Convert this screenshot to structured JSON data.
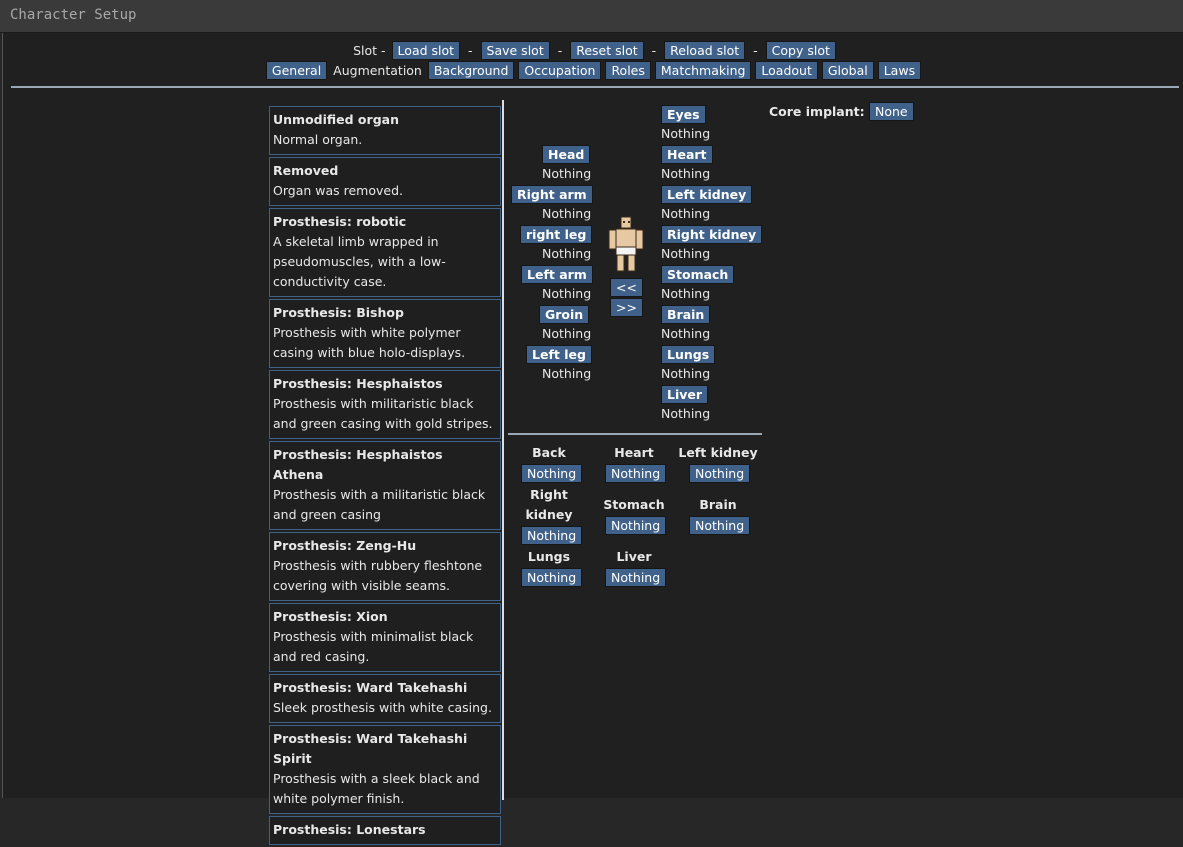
{
  "window": {
    "title": "Character Setup"
  },
  "slot": {
    "label": "Slot -",
    "sep": "-",
    "buttons": [
      "Load slot",
      "Save slot",
      "Reset slot",
      "Reload slot",
      "Copy slot"
    ]
  },
  "tabs": {
    "general": "General",
    "augmentation": "Augmentation",
    "background": "Background",
    "occupation": "Occupation",
    "roles": "Roles",
    "matchmaking": "Matchmaking",
    "loadout": "Loadout",
    "global": "Global",
    "laws": "Laws"
  },
  "prosthetics": [
    {
      "name": "Unmodified organ",
      "desc": "Normal organ."
    },
    {
      "name": "Removed",
      "desc": "Organ was removed."
    },
    {
      "name": "Prosthesis: robotic",
      "desc": "A skeletal limb wrapped in pseudomuscles, with a low-conductivity case."
    },
    {
      "name": "Prosthesis: Bishop",
      "desc": "Prosthesis with white polymer casing with blue holo-displays."
    },
    {
      "name": "Prosthesis: Hesphaistos",
      "desc": "Prosthesis with militaristic black and green casing with gold stripes."
    },
    {
      "name": "Prosthesis: Hesphaistos Athena",
      "desc": "Prosthesis with a militaristic black and green casing"
    },
    {
      "name": "Prosthesis: Zeng-Hu",
      "desc": "Prosthesis with rubbery fleshtone covering with visible seams."
    },
    {
      "name": "Prosthesis: Xion",
      "desc": "Prosthesis with minimalist black and red casing."
    },
    {
      "name": "Prosthesis: Ward Takehashi",
      "desc": "Sleek prosthesis with white casing."
    },
    {
      "name": "Prosthesis: Ward Takehashi Spirit",
      "desc": "Prosthesis with a sleek black and white polymer finish."
    },
    {
      "name": "Prosthesis: Lonestars",
      "desc": ""
    }
  ],
  "limbs": {
    "left_column": [
      {
        "label": "Head",
        "value": "Nothing"
      },
      {
        "label": "Right arm",
        "value": "Nothing"
      },
      {
        "label": "right leg",
        "value": "Nothing"
      },
      {
        "label": "Left arm",
        "value": "Nothing"
      },
      {
        "label": "Groin",
        "value": "Nothing"
      },
      {
        "label": "Left leg",
        "value": "Nothing"
      }
    ],
    "right_column": [
      {
        "label": "Eyes",
        "value": "Nothing"
      },
      {
        "label": "Heart",
        "value": "Nothing"
      },
      {
        "label": "Left kidney",
        "value": "Nothing"
      },
      {
        "label": "Right kidney",
        "value": "Nothing"
      },
      {
        "label": "Stomach",
        "value": "Nothing"
      },
      {
        "label": "Brain",
        "value": "Nothing"
      },
      {
        "label": "Lungs",
        "value": "Nothing"
      },
      {
        "label": "Liver",
        "value": "Nothing"
      }
    ]
  },
  "rotate": {
    "left": "<<",
    "right": ">>"
  },
  "internal": [
    {
      "label": "Back",
      "value": "Nothing"
    },
    {
      "label": "Heart",
      "value": "Nothing"
    },
    {
      "label": "Left kidney",
      "value": "Nothing"
    },
    {
      "label_line1": "Right",
      "label_line2": "kidney",
      "value": "Nothing"
    },
    {
      "label": "Stomach",
      "value": "Nothing"
    },
    {
      "label": "Brain",
      "value": "Nothing"
    },
    {
      "label": "Lungs",
      "value": "Nothing"
    },
    {
      "label": "Liver",
      "value": "Nothing"
    }
  ],
  "core_implant": {
    "label": "Core implant:",
    "value": "None"
  }
}
